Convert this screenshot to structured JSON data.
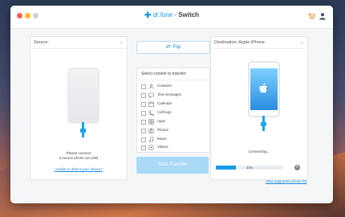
{
  "window": {
    "brand_logo": "dr.fone",
    "brand_sep": " - ",
    "brand_app": "Switch"
  },
  "source": {
    "header": "Source:",
    "message_line1": "Please connect",
    "message_line2": "a source phone via USB",
    "link": "Unable to detect your device?"
  },
  "flip": {
    "label": "Flip"
  },
  "content": {
    "header": "Select content to transfer:",
    "items": [
      {
        "label": "Contacts",
        "icon": "contacts-icon"
      },
      {
        "label": "Text messages",
        "icon": "messages-icon"
      },
      {
        "label": "Calendar",
        "icon": "calendar-icon"
      },
      {
        "label": "Call logs",
        "icon": "call-logs-icon"
      },
      {
        "label": "Apps",
        "icon": "apps-icon"
      },
      {
        "label": "Photos",
        "icon": "photos-icon"
      },
      {
        "label": "Music",
        "icon": "music-icon"
      },
      {
        "label": "Videos",
        "icon": "videos-icon"
      }
    ]
  },
  "start": {
    "label": "Start Transfer"
  },
  "destination": {
    "header": "Destination: Apple iPhone",
    "status": "Connecting...",
    "progress_label": "30%",
    "progress_value": 0.3,
    "link": "View supported phone list"
  },
  "colors": {
    "accent": "#1a9be8",
    "link": "#1a8ce0",
    "button_disabled": "#a9d9f5"
  }
}
